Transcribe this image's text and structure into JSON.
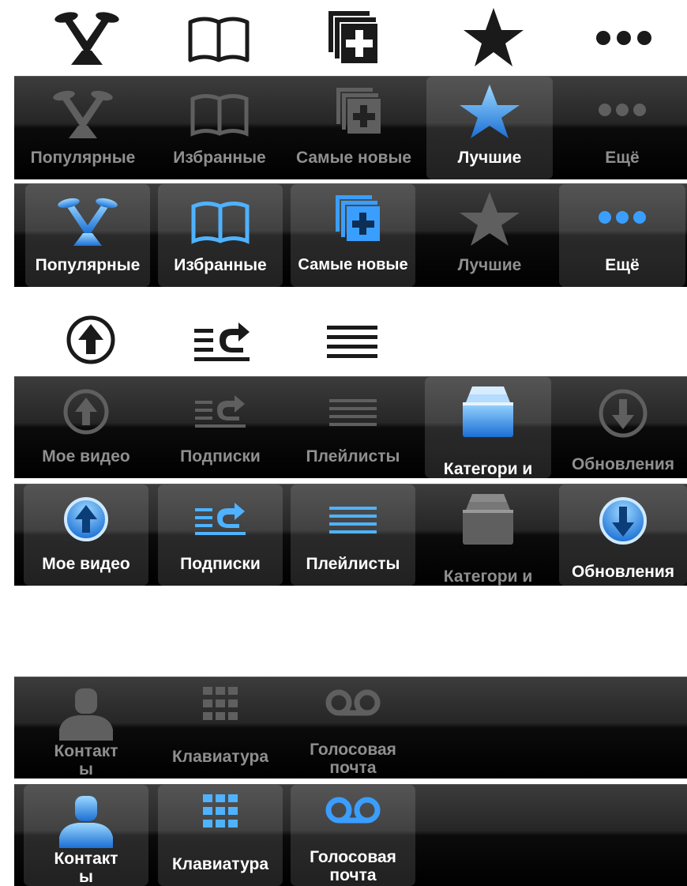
{
  "icon_set_1": {
    "plain_icons": [
      "spotlight-icon",
      "book-icon",
      "add-layers-icon",
      "star-icon",
      "more-dots-icon"
    ],
    "bar_a": {
      "selected": "top_rated",
      "tabs": [
        {
          "id": "popular",
          "label": "Популярные",
          "icon": "spotlight-icon"
        },
        {
          "id": "favorites",
          "label": "Избранные",
          "icon": "book-icon"
        },
        {
          "id": "newest",
          "label": "Самые новые",
          "icon": "add-layers-icon"
        },
        {
          "id": "top_rated",
          "label": "Лучшие",
          "icon": "star-icon"
        },
        {
          "id": "more",
          "label": "Ещё",
          "icon": "more-dots-icon"
        }
      ]
    },
    "bar_b": {
      "selected": [
        "popular",
        "favorites",
        "newest",
        "more"
      ],
      "tabs": [
        {
          "id": "popular",
          "label": "Популярные"
        },
        {
          "id": "favorites",
          "label": "Избранные"
        },
        {
          "id": "newest",
          "label": "Самые новые"
        },
        {
          "id": "top_rated",
          "label": "Лучшие"
        },
        {
          "id": "more",
          "label": "Ещё"
        }
      ]
    }
  },
  "icon_set_2": {
    "plain_icons": [
      "upload-circle-icon",
      "subscriptions-icon",
      "playlist-icon"
    ],
    "bar_a": {
      "selected": "categories",
      "tabs": [
        {
          "id": "my_videos",
          "label": "Мое видео",
          "icon": "upload-circle-icon"
        },
        {
          "id": "subscriptions",
          "label": "Подписки",
          "icon": "subscriptions-icon"
        },
        {
          "id": "playlists",
          "label": "Плейлисты",
          "icon": "playlist-icon"
        },
        {
          "id": "categories",
          "label": "Категори и",
          "icon": "archive-box-icon"
        },
        {
          "id": "updates",
          "label": "Обновления",
          "icon": "download-circle-icon"
        }
      ]
    },
    "bar_b": {
      "selected": [
        "my_videos",
        "subscriptions",
        "playlists",
        "updates"
      ],
      "tabs": [
        {
          "id": "my_videos",
          "label": "Мое видео"
        },
        {
          "id": "subscriptions",
          "label": "Подписки"
        },
        {
          "id": "playlists",
          "label": "Плейлисты"
        },
        {
          "id": "categories",
          "label": "Категори и"
        },
        {
          "id": "updates",
          "label": "Обновления"
        }
      ]
    }
  },
  "icon_set_3": {
    "bar_a": {
      "selected": [],
      "tabs": [
        {
          "id": "contacts",
          "label": "Контакт ы",
          "icon": "person-icon"
        },
        {
          "id": "keypad",
          "label": "Клавиатура",
          "icon": "keypad-grid-icon"
        },
        {
          "id": "voicemail",
          "label": "Голосовая почта",
          "icon": "voicemail-icon"
        }
      ]
    },
    "bar_b": {
      "selected": [
        "contacts",
        "keypad",
        "voicemail"
      ],
      "tabs": [
        {
          "id": "contacts",
          "label": "Контакт ы"
        },
        {
          "id": "keypad",
          "label": "Клавиатура"
        },
        {
          "id": "voicemail",
          "label": "Голосовая почта"
        }
      ]
    }
  },
  "colors": {
    "plain_icon": "#1a1a1a",
    "inactive_icon": "#5f5f5f",
    "inactive_label": "#8f8f8f",
    "active_label": "#ffffff",
    "active_icon_light": "#8fd0ff",
    "active_icon_dark": "#1a6fd6"
  }
}
